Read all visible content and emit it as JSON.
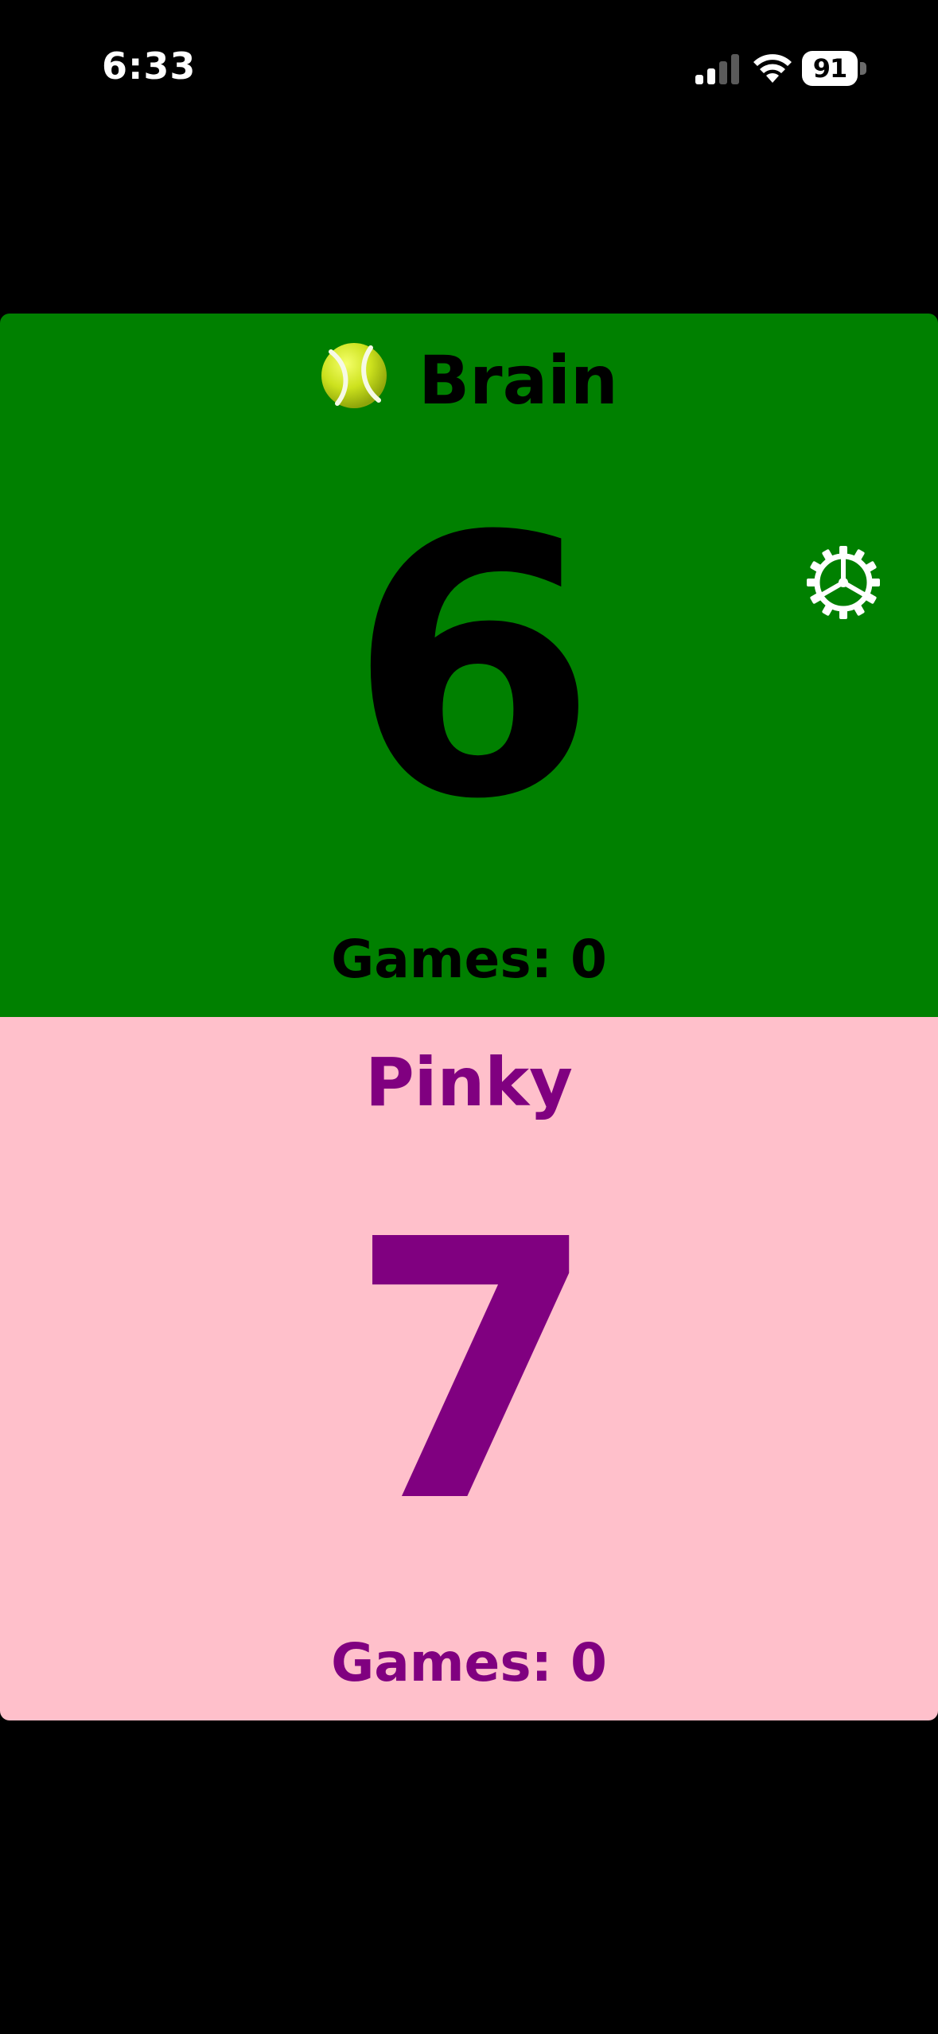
{
  "status_bar": {
    "time": "6:33",
    "battery_level": "91",
    "signal_icon": "cellular-signal-icon",
    "wifi_icon": "wifi-icon",
    "battery_icon": "battery-icon"
  },
  "players": [
    {
      "name": "Brain",
      "score": "6",
      "games_text": "Games: 0",
      "serving": true,
      "serve_icon": "tennis-ball-icon",
      "background_color": "#008000",
      "text_color": "#000000"
    },
    {
      "name": "Pinky",
      "score": "7",
      "games_text": "Games: 0",
      "serving": false,
      "background_color": "#ffc0cb",
      "text_color": "#800080"
    }
  ],
  "settings": {
    "icon": "gear-icon"
  }
}
